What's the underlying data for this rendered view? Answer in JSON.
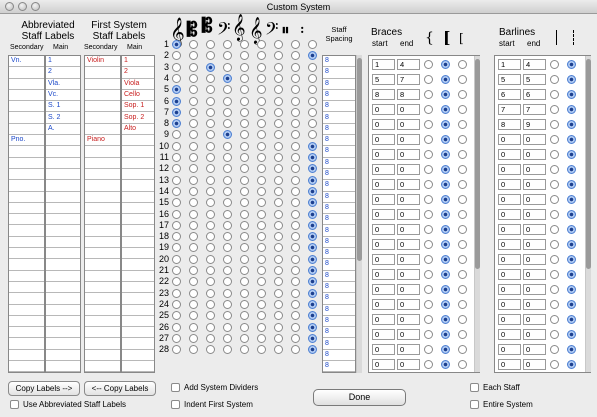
{
  "window": {
    "title": "Custom System"
  },
  "labels": {
    "abbrev_title": "Abbreviated\nStaff Labels",
    "first_title": "First System\nStaff Labels",
    "secondary": "Secondary",
    "main": "Main"
  },
  "abbrev_secondary": [
    "Vn.",
    "",
    "",
    "",
    "",
    "",
    "",
    "Pno."
  ],
  "abbrev_main": [
    "1",
    "2",
    "Vla.",
    "Vc.",
    "S. 1",
    "S. 2",
    "A.",
    "",
    "",
    ""
  ],
  "first_secondary": [
    "Violin",
    "",
    "",
    "",
    "",
    "",
    "",
    "Piano"
  ],
  "first_main": [
    "1",
    "2",
    "Viola",
    "Cello",
    "Sop. 1",
    "Sop. 2",
    "Alto",
    "",
    "",
    ""
  ],
  "staff_rows": [
    "1",
    "2",
    "3",
    "4",
    "5",
    "6",
    "7",
    "8",
    "9",
    "10",
    "11",
    "12",
    "13",
    "14",
    "15",
    "16",
    "17",
    "18",
    "19",
    "20",
    "21",
    "22",
    "23",
    "24",
    "25",
    "26",
    "27",
    "28"
  ],
  "clef_selection": [
    0,
    8,
    2,
    3,
    0,
    0,
    0,
    0,
    3,
    8,
    8,
    8,
    8,
    8,
    8,
    8,
    8,
    8,
    8,
    8,
    8,
    8,
    8,
    8,
    8,
    8,
    8,
    8
  ],
  "staff_spacing": {
    "title": "Staff\nSpacing",
    "values": [
      "8",
      "8",
      "8",
      "8",
      "8",
      "8",
      "8",
      "8",
      "8",
      "8",
      "8",
      "8",
      "8",
      "8",
      "8",
      "8",
      "8",
      "8",
      "8",
      "8",
      "8",
      "8",
      "8",
      "8",
      "8",
      "8",
      "8",
      "8"
    ]
  },
  "braces": {
    "title": "Braces",
    "start": "start",
    "end": "end",
    "rows": [
      [
        "1",
        "4",
        0
      ],
      [
        "5",
        "7",
        0
      ],
      [
        "8",
        "8",
        0
      ],
      [
        "0",
        "0",
        0
      ],
      [
        "0",
        "0",
        0
      ],
      [
        "0",
        "0",
        0
      ],
      [
        "0",
        "0",
        0
      ],
      [
        "0",
        "0",
        0
      ],
      [
        "0",
        "0",
        0
      ],
      [
        "0",
        "0",
        0
      ],
      [
        "0",
        "0",
        0
      ],
      [
        "0",
        "0",
        0
      ],
      [
        "0",
        "0",
        0
      ],
      [
        "0",
        "0",
        0
      ],
      [
        "0",
        "0",
        0
      ],
      [
        "0",
        "0",
        0
      ],
      [
        "0",
        "0",
        0
      ],
      [
        "0",
        "0",
        0
      ],
      [
        "0",
        "0",
        0
      ],
      [
        "0",
        "0",
        0
      ],
      [
        "0",
        "0",
        0
      ]
    ]
  },
  "barlines": {
    "title": "Barlines",
    "start": "start",
    "end": "end",
    "rows": [
      [
        "1",
        "4",
        0
      ],
      [
        "5",
        "5",
        0
      ],
      [
        "6",
        "6",
        0
      ],
      [
        "7",
        "7",
        0
      ],
      [
        "8",
        "9",
        0
      ],
      [
        "0",
        "0",
        0
      ],
      [
        "0",
        "0",
        0
      ],
      [
        "0",
        "0",
        0
      ],
      [
        "0",
        "0",
        0
      ],
      [
        "0",
        "0",
        0
      ],
      [
        "0",
        "0",
        0
      ],
      [
        "0",
        "0",
        0
      ],
      [
        "0",
        "0",
        0
      ],
      [
        "0",
        "0",
        0
      ],
      [
        "0",
        "0",
        0
      ],
      [
        "0",
        "0",
        0
      ],
      [
        "0",
        "0",
        0
      ],
      [
        "0",
        "0",
        0
      ],
      [
        "0",
        "0",
        0
      ],
      [
        "0",
        "0",
        0
      ],
      [
        "0",
        "0",
        0
      ]
    ]
  },
  "buttons": {
    "copy_right": "Copy Labels -->",
    "copy_left": "<-- Copy Labels",
    "done": "Done"
  },
  "checkboxes": {
    "abbrev": "Use Abbreviated Staff Labels",
    "dividers": "Add System Dividers",
    "indent": "Indent First System",
    "each_staff": "Each Staff",
    "entire_system": "Entire System"
  },
  "icons": {
    "clefs": [
      "treble-clef",
      "alto-clef",
      "tenor-clef",
      "bass-clef",
      "treble-8va-clef",
      "treble-8vb-clef",
      "bass-8vb-clef",
      "percussion-clef",
      "tab-clef"
    ],
    "brace": "brace-icon",
    "bracket": "bracket-icon",
    "sub-bracket": "sub-bracket-icon",
    "barline": "barline-icon",
    "dashed-barline": "dashed-barline-icon"
  }
}
